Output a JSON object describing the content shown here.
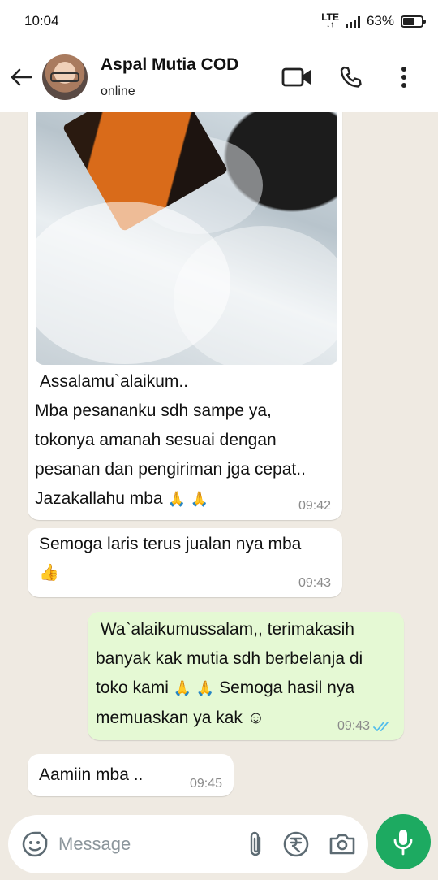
{
  "status_bar": {
    "time": "10:04",
    "network": "LTE",
    "battery": "63%"
  },
  "header": {
    "contact_name": "Aspal Mutia COD",
    "contact_status": "online"
  },
  "messages": [
    {
      "direction": "in",
      "has_photo": true,
      "text": " Assalamu`alaikum..\nMba pesananku sdh sampe ya,\ntokonya amanah sesuai dengan\npesanan dan pengiriman jga cepat..\nJazakallahu mba ",
      "emoji": "🙏 🙏",
      "time": "09:42"
    },
    {
      "direction": "in",
      "text": "Semoga laris terus jualan nya mba",
      "emoji": "👍",
      "time": "09:43"
    },
    {
      "direction": "out",
      "text_1": " Wa`alaikumussalam,, terimakasih\nbanyak kak mutia sdh berbelanja di\ntoko kami ",
      "emoji": "🙏 🙏",
      "text_2": " Semoga hasil nya\nmemuaskan ya kak ☺",
      "time": "09:43",
      "status": "read"
    },
    {
      "direction": "in",
      "text": "Aamiin mba ..",
      "time": "09:45"
    }
  ],
  "composer": {
    "placeholder": "Message"
  },
  "colors": {
    "accent": "#1daa61",
    "outgoing_bubble": "#e5f9d4",
    "chat_bg": "#efeae2",
    "read_ticks": "#53bdeb"
  }
}
